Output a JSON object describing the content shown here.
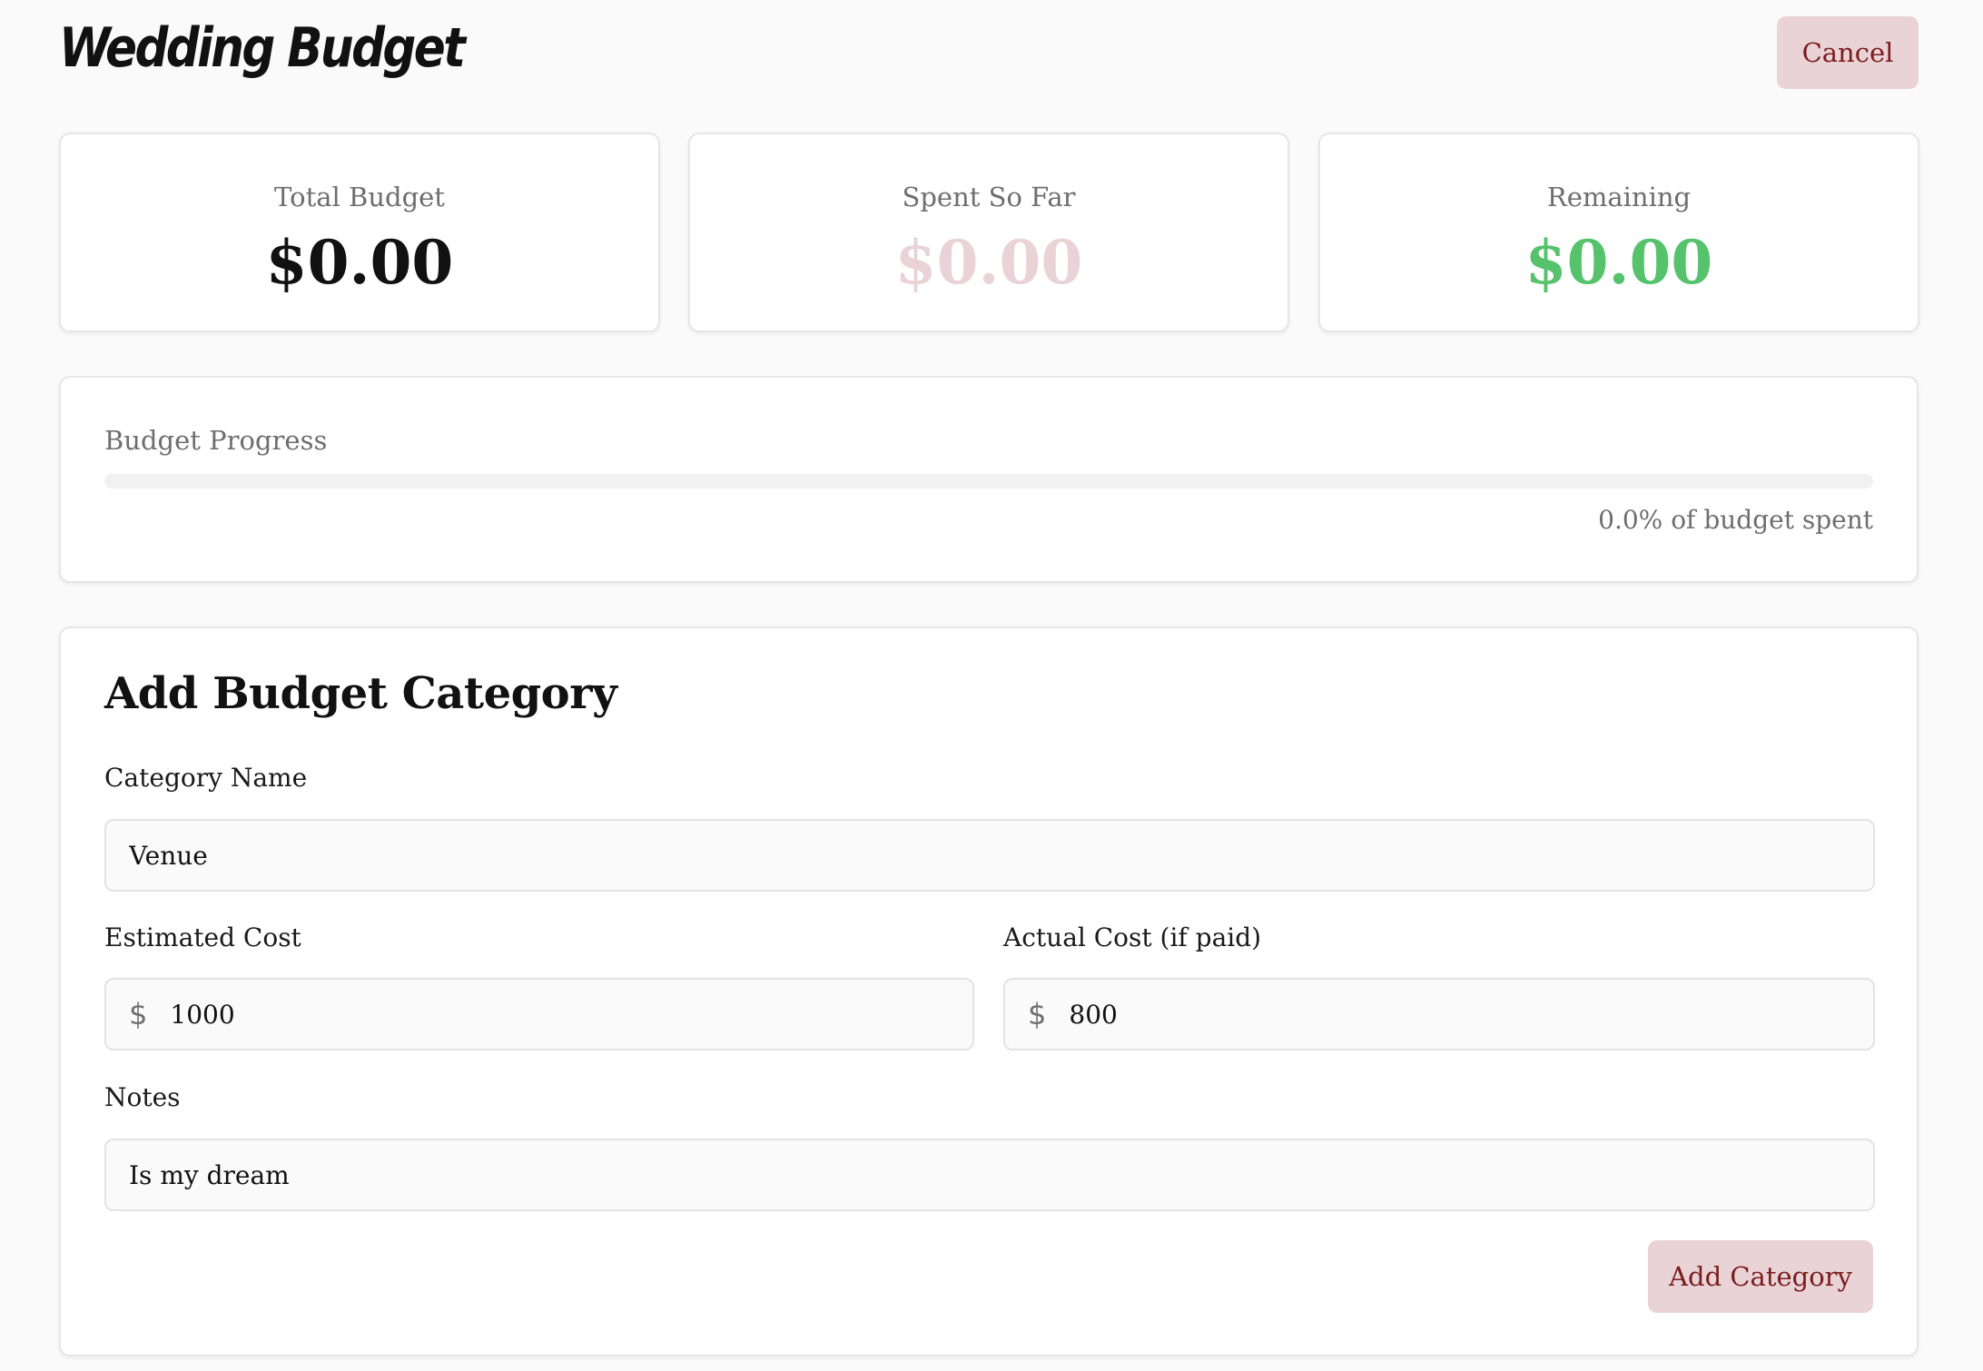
{
  "header": {
    "title": "Wedding Budget",
    "cancel_label": "Cancel"
  },
  "stats": {
    "total": {
      "label": "Total Budget",
      "value": "$0.00"
    },
    "spent": {
      "label": "Spent So Far",
      "value": "$0.00"
    },
    "remaining": {
      "label": "Remaining",
      "value": "$0.00"
    }
  },
  "progress": {
    "title": "Budget Progress",
    "percent": 0.0,
    "text": "0.0% of budget spent"
  },
  "form": {
    "title": "Add Budget Category",
    "category_name": {
      "label": "Category Name",
      "value": "Venue"
    },
    "estimated_cost": {
      "label": "Estimated Cost",
      "prefix": "$",
      "value": "1000"
    },
    "actual_cost": {
      "label": "Actual Cost (if paid)",
      "prefix": "$",
      "value": "800"
    },
    "notes": {
      "label": "Notes",
      "value": "Is my dream"
    },
    "submit_label": "Add Category"
  },
  "colors": {
    "accent_bg": "#ead3d7",
    "accent_text": "#7a1d1d",
    "remaining_green": "#56c26b",
    "muted_text": "#6e6e6e"
  }
}
